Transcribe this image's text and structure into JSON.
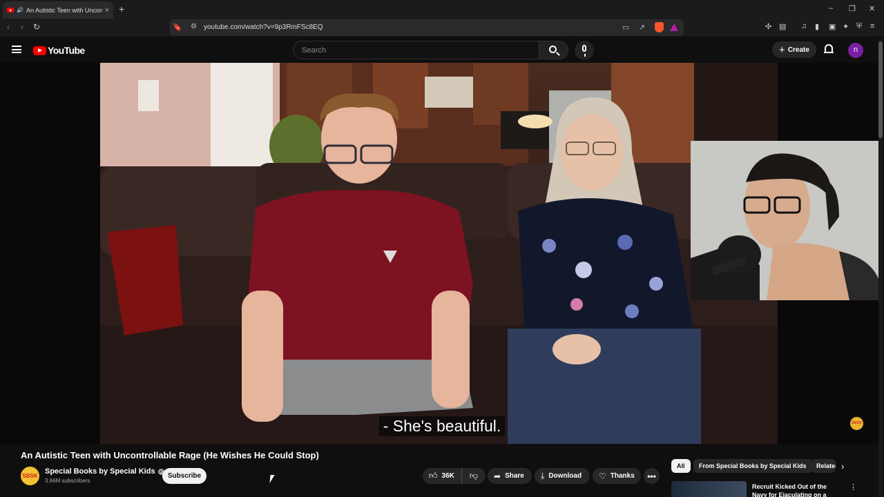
{
  "browser": {
    "tab_title": "An Autistic Teen with Uncontrollable Rage (He Wishes He Could Stop)",
    "url": "youtube.com/watch?v=9p3RmFSc8EQ"
  },
  "header": {
    "logo_text": "YouTube",
    "search_placeholder": "Search",
    "create_label": "Create",
    "avatar_letter": "n"
  },
  "video": {
    "caption": "- She's beautiful.",
    "title": "An Autistic Teen with Uncontrollable Rage (He Wishes He Could Stop)",
    "channel": {
      "name": "Special Books by Special Kids",
      "subscribers": "3.66M subscribers",
      "avatar_text": "SBSK"
    },
    "subscribe_label": "Subscribe",
    "actions": {
      "likes": "36K",
      "share": "Share",
      "download": "Download",
      "thanks": "Thanks"
    }
  },
  "sidebar": {
    "chips": [
      "All",
      "From Special Books by Special Kids",
      "Related"
    ],
    "related": [
      {
        "title": "Recruit Kicked Out of the Navy for Ejaculating on a Pillow |"
      }
    ]
  },
  "colors": {
    "youtube_red": "#ff0000",
    "background": "#0f0f0f",
    "avatar_purple": "#7a1fa2"
  }
}
